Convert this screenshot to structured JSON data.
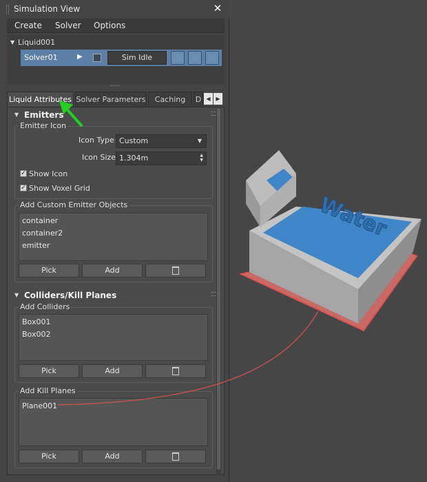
{
  "window": {
    "title": "Simulation View",
    "close_label": "✕"
  },
  "menu": [
    "Create",
    "Solver",
    "Options"
  ],
  "tree": {
    "root": "Liquid001",
    "solver": "Solver01",
    "status": "Sim Idle"
  },
  "tabs": [
    "Liquid Attributes",
    "Solver Parameters",
    "Caching",
    "D"
  ],
  "emitters": {
    "title": "Emitters",
    "icon_group": "Emitter Icon",
    "icon_type_label": "Icon Type",
    "icon_type_value": "Custom",
    "icon_size_label": "Icon Size",
    "icon_size_value": "1.304m",
    "show_icon": "Show Icon",
    "show_voxel": "Show Voxel Grid",
    "custom_group": "Add Custom Emitter Objects",
    "objects": [
      "container",
      "container2",
      "emitter"
    ],
    "pick": "Pick",
    "add": "Add"
  },
  "colliders": {
    "title": "Colliders/Kill Planes",
    "colliders_group": "Add Colliders",
    "collider_items": [
      "Box001",
      "Box002"
    ],
    "kill_group": "Add Kill Planes",
    "kill_items": [
      "Plane001"
    ],
    "pick": "Pick",
    "add": "Add"
  },
  "scene": {
    "text": "Water"
  },
  "colors": {
    "accent_blue": "#5b7fa6",
    "water": "#3f86c9",
    "arrow_green": "#22d022",
    "kill_plane_red": "#d9534f"
  }
}
